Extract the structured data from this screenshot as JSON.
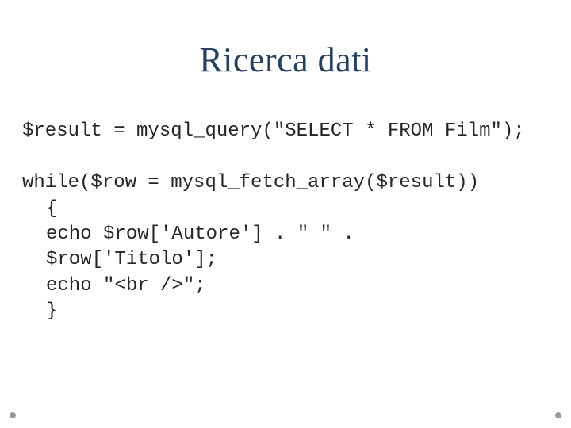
{
  "title": "Ricerca dati",
  "code": {
    "l1": "$result = mysql_query(\"SELECT * FROM Film\");",
    "blank1": "",
    "l2": "while($row = mysql_fetch_array($result))",
    "l3": "{",
    "l4": "echo $row['Autore'] . \" \" .",
    "l5": "$row['Titolo'];",
    "l6": "echo \"<br />\";",
    "l7": "}"
  }
}
